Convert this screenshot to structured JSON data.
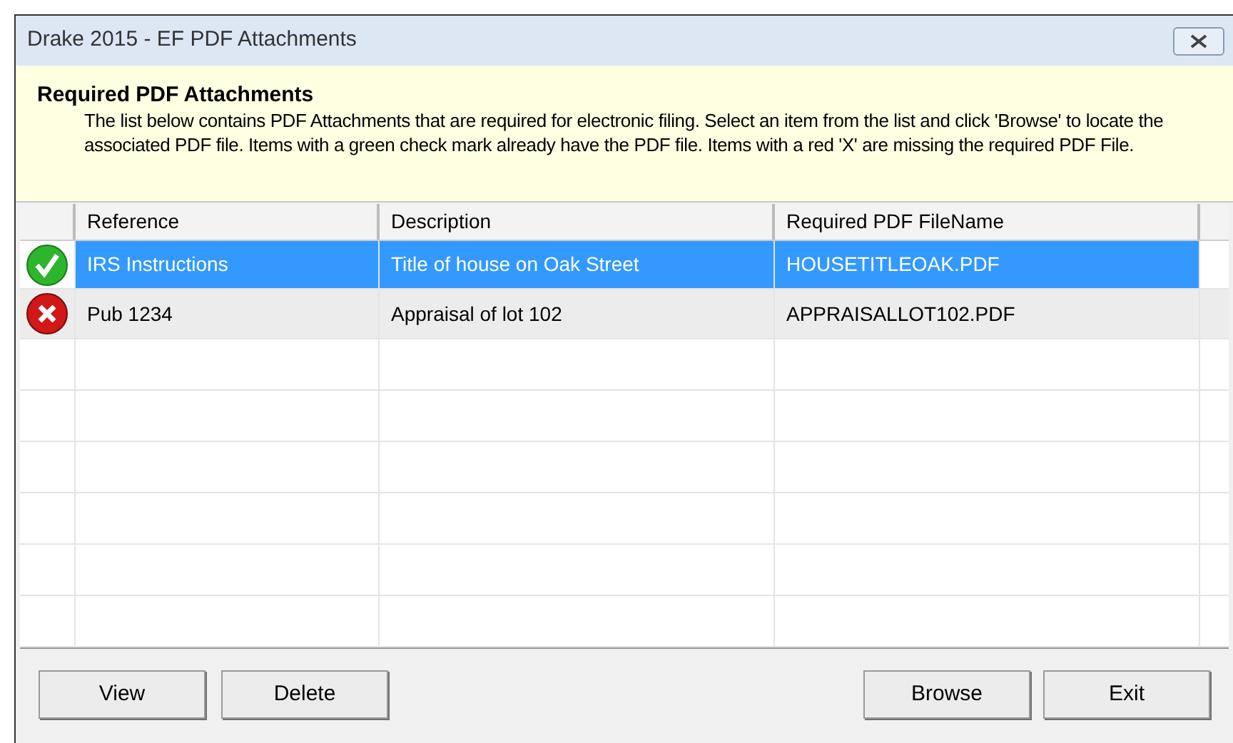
{
  "window": {
    "title": "Drake 2015 - EF PDF Attachments"
  },
  "header": {
    "title": "Required PDF Attachments",
    "text": "The list below contains PDF Attachments that are required for electronic filing. Select an item from the list and click 'Browse' to locate the associated PDF file. Items with a green check mark already have the PDF file. Items with a red 'X' are missing the required PDF File."
  },
  "table": {
    "columns": [
      "Reference",
      "Description",
      "Required PDF FileName"
    ],
    "rows": [
      {
        "kind": "ok",
        "selected": true,
        "cells": [
          "IRS Instructions",
          "Title of house on Oak Street",
          "HOUSETITLEOAK.PDF"
        ]
      },
      {
        "kind": "missing",
        "selected": false,
        "cells": [
          "Pub 1234",
          "Appraisal of lot 102",
          "APPRAISALLOT102.PDF"
        ]
      }
    ]
  },
  "buttons_left": [
    "View",
    "Delete"
  ],
  "buttons_right": [
    "Browse",
    "Exit"
  ]
}
